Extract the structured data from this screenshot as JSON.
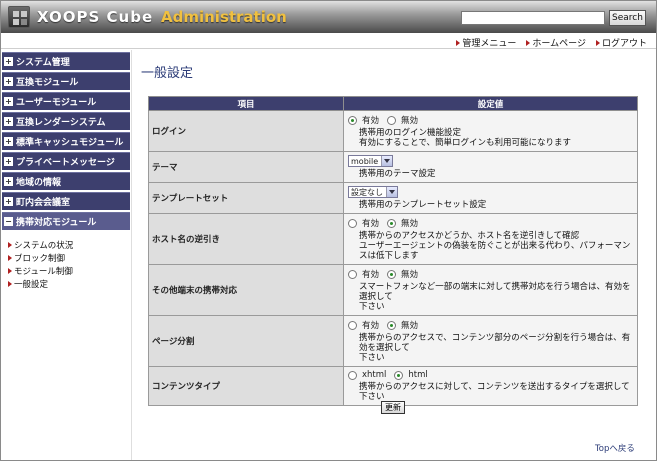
{
  "header": {
    "logo_text": "XOOPS Cube",
    "admin_text": "Administration",
    "search_placeholder": "",
    "search_button": "Search"
  },
  "topnav": [
    {
      "label": "管理メニュー",
      "icon": "triangle-right-icon"
    },
    {
      "label": "ホームページ",
      "icon": "triangle-right-icon"
    },
    {
      "label": "ログアウト",
      "icon": "triangle-right-icon"
    }
  ],
  "sidebar": {
    "categories": [
      {
        "label": "システム管理",
        "state": "+"
      },
      {
        "label": "互換モジュール",
        "state": "+"
      },
      {
        "label": "ユーザーモジュール",
        "state": "+"
      },
      {
        "label": "互換レンダーシステム",
        "state": "+"
      },
      {
        "label": "標準キャッシュモジュール",
        "state": "+"
      },
      {
        "label": "プライベートメッセージ",
        "state": "+"
      },
      {
        "label": "地域の情報",
        "state": "+"
      },
      {
        "label": "町内会会議室",
        "state": "+"
      },
      {
        "label": "携帯対応モジュール",
        "state": "−"
      }
    ],
    "sub_items": [
      {
        "label": "システムの状況"
      },
      {
        "label": "ブロック制御"
      },
      {
        "label": "モジュール制御"
      },
      {
        "label": "一般設定"
      }
    ]
  },
  "main": {
    "page_title": "一般設定",
    "table": {
      "col_item": "項目",
      "col_value": "設定値",
      "rows": {
        "login": {
          "label": "ログイン",
          "opt1": "有効",
          "opt2": "無効",
          "selected": 1,
          "desc1": "携帯用のログイン機能設定",
          "desc2": "有効にすることで、簡単ログインも利用可能になります"
        },
        "theme": {
          "label": "テーマ",
          "select_value": "mobile",
          "desc1": "携帯用のテーマ設定"
        },
        "template": {
          "label": "テンプレートセット",
          "select_value": "設定なし",
          "desc1": "携帯用のテンプレートセット設定"
        },
        "host": {
          "label": "ホスト名の逆引き",
          "opt1": "有効",
          "opt2": "無効",
          "selected": 2,
          "desc1": "携帯からのアクセスかどうか、ホスト名を逆引きして確認",
          "desc2": "ユーザーエージェントの偽装を防ぐことが出来る代わり、パフォーマンスは低下します"
        },
        "other": {
          "label": "その他端末の携帯対応",
          "opt1": "有効",
          "opt2": "無効",
          "selected": 2,
          "desc1": "スマートフォンなど一部の端末に対して携帯対応を行う場合は、有効を選択して",
          "desc2": "下さい"
        },
        "paging": {
          "label": "ページ分割",
          "opt1": "有効",
          "opt2": "無効",
          "selected": 2,
          "desc1": "携帯からのアクセスで、コンテンツ部分のページ分割を行う場合は、有効を選択して",
          "desc2": "下さい"
        },
        "ctype": {
          "label": "コンテンツタイプ",
          "opt1": "xhtml",
          "opt2": "html",
          "selected": 2,
          "desc1": "携帯からのアクセスに対して、コンテンツを送出するタイプを選択して下さい"
        }
      }
    },
    "submit_label": "更新",
    "top_link": "Topへ戻る"
  }
}
